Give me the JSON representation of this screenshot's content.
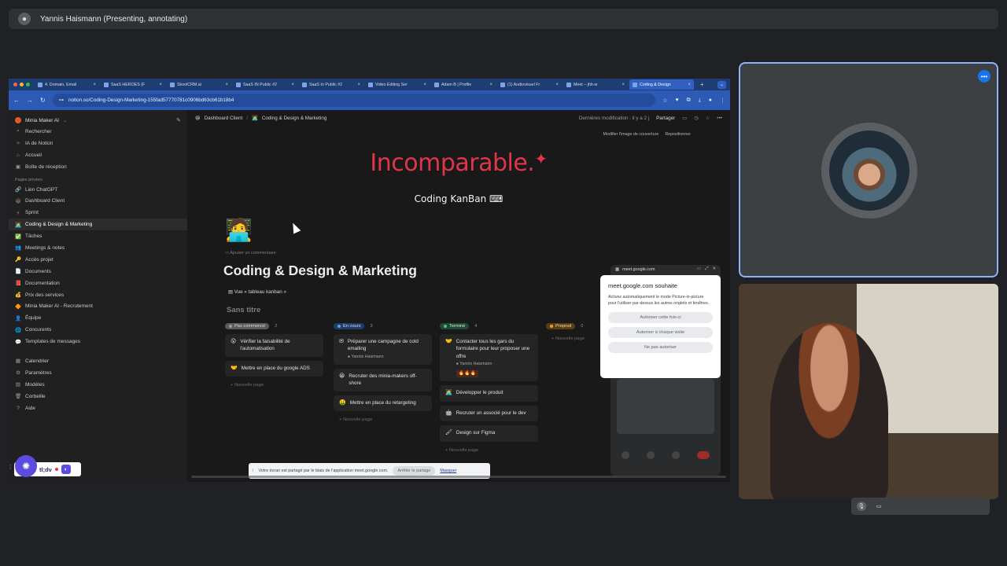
{
  "meet": {
    "presenter_title": "Yannis Haismann (Presenting, annotating)"
  },
  "browser": {
    "tabs": [
      {
        "label": "4. Domain, Email"
      },
      {
        "label": "SaaS HEROES (F"
      },
      {
        "label": "SkoolCRM.ai"
      },
      {
        "label": "SaaS IN Public #2"
      },
      {
        "label": "SaaS In Public #2"
      },
      {
        "label": "Video Editing Ser"
      },
      {
        "label": "Adam B | Profile"
      },
      {
        "label": "(1) Audiovisuel Fr"
      },
      {
        "label": "Meet – jhh-w"
      },
      {
        "label": "Coding & Design"
      }
    ],
    "url": "notion.so/Coding-Design-Marketing-155fad57770781c0906bd63cb61b18b4"
  },
  "notion": {
    "workspace": "Minia Maker AI",
    "nav": [
      {
        "icon": "⌕",
        "label": "Rechercher"
      },
      {
        "icon": "✧",
        "label": "IA de Notion"
      },
      {
        "icon": "⌂",
        "label": "Accueil"
      },
      {
        "icon": "▣",
        "label": "Boîte de réception"
      }
    ],
    "private_label": "Pages privées",
    "pages": [
      {
        "icon": "🔗",
        "label": "Lien ChatGPT"
      },
      {
        "icon": "😀",
        "label": "Dashboard Client"
      },
      {
        "icon": "⚡",
        "label": "Sprint"
      },
      {
        "icon": "🧑‍💻",
        "label": "Coding & Design & Marketing"
      },
      {
        "icon": "✅",
        "label": "Tâches"
      },
      {
        "icon": "👥",
        "label": "Meetings & notes"
      },
      {
        "icon": "🔑",
        "label": "Accès projet"
      },
      {
        "icon": "📄",
        "label": "Documents"
      },
      {
        "icon": "📕",
        "label": "Documentation"
      },
      {
        "icon": "💰",
        "label": "Prix des services"
      },
      {
        "icon": "🔶",
        "label": "Minia Maker AI - Recrutement"
      },
      {
        "icon": "👤",
        "label": "Équipe"
      },
      {
        "icon": "🌐",
        "label": "Concurents"
      },
      {
        "icon": "💬",
        "label": "Templates de messages"
      }
    ],
    "footer": [
      {
        "icon": "▦",
        "label": "Calendrier"
      },
      {
        "icon": "⚙",
        "label": "Paramètres"
      },
      {
        "icon": "▤",
        "label": "Modèles"
      },
      {
        "icon": "🗑",
        "label": "Corbeille"
      },
      {
        "icon": "?",
        "label": "Aide"
      }
    ],
    "breadcrumb": {
      "parent": "Dashboard Client",
      "current": "Coding & Design & Marketing",
      "separator": "/"
    },
    "last_edit": "Dernières modification : il y a 2 j",
    "share_label": "Partager",
    "cover_actions": {
      "change": "Modifier l'image de couverture",
      "reposition": "Repositionner"
    },
    "cover_title": "Incomparable.",
    "cover_subtitle": "Coding KanBan",
    "add_comment": "Ajouter un commentaire",
    "page_title": "Coding & Design & Marketing",
    "view_label": "Vue « tableau kanban »",
    "group_title": "Sans titre",
    "columns": [
      {
        "status": "Pas commencé",
        "count": "2",
        "color": "#5a5a5a",
        "dot": "#9b9b9b",
        "text": "#dddddd",
        "cards": [
          {
            "icon": "😮",
            "title": "Vérifier la faisabilité de l'automatisation"
          },
          {
            "icon": "🤝",
            "title": "Mettre en place du google ADS"
          }
        ],
        "new_page": "Nouvelle page"
      },
      {
        "status": "En cours",
        "count": "3",
        "color": "#1f3b66",
        "dot": "#5b9cf0",
        "text": "#cfe0ff",
        "cards": [
          {
            "icon": "✉",
            "title": "Préparer une campagne de cold emailing",
            "assignee": "Yannis Haismann"
          },
          {
            "icon": "😀",
            "title": "Recruter des minia-makers off-shore"
          },
          {
            "icon": "🤑",
            "title": "Mettre en place du retargeting"
          }
        ],
        "new_page": "Nouvelle page"
      },
      {
        "status": "Terminé",
        "count": "4",
        "color": "#1f4a33",
        "dot": "#4cbf7a",
        "text": "#cdeedd",
        "cards": [
          {
            "icon": "🤝",
            "title": "Contacter tous les gars du formulaire pour leur proposer une offre",
            "assignee": "Yannis Haismann",
            "tag": "🔥🔥🔥"
          },
          {
            "icon": "🧑‍💻",
            "title": "Développer le produit"
          },
          {
            "icon": "🤖",
            "title": "Recruter un associé pour le dev"
          },
          {
            "icon": "🖌",
            "title": "Design sur Figma"
          }
        ],
        "new_page": "Nouvelle page"
      },
      {
        "status": "Preprod",
        "count": "0",
        "color": "#5a3e12",
        "dot": "#e0a030",
        "text": "#f3dcb0",
        "cards": [],
        "new_page": "Nouvelle page"
      }
    ]
  },
  "pip": {
    "domain": "meet.google.com",
    "dialog_title": "meet.google.com souhaite",
    "dialog_text": "Activez automatiquement le mode Picture-in-picture pour l'utiliser par-dessus les autres onglets et fenêtres.",
    "buttons": [
      "Autoriser cette fois-ci",
      "Autoriser à chaque visite",
      "Ne pas autoriser"
    ]
  },
  "share_banner": {
    "text": "Votre écran est partagé par le biais de l'application meet.google.com.",
    "stop": "Arrêter le partage",
    "hide": "Masquer"
  },
  "tldv": {
    "label": "tl;dv"
  }
}
